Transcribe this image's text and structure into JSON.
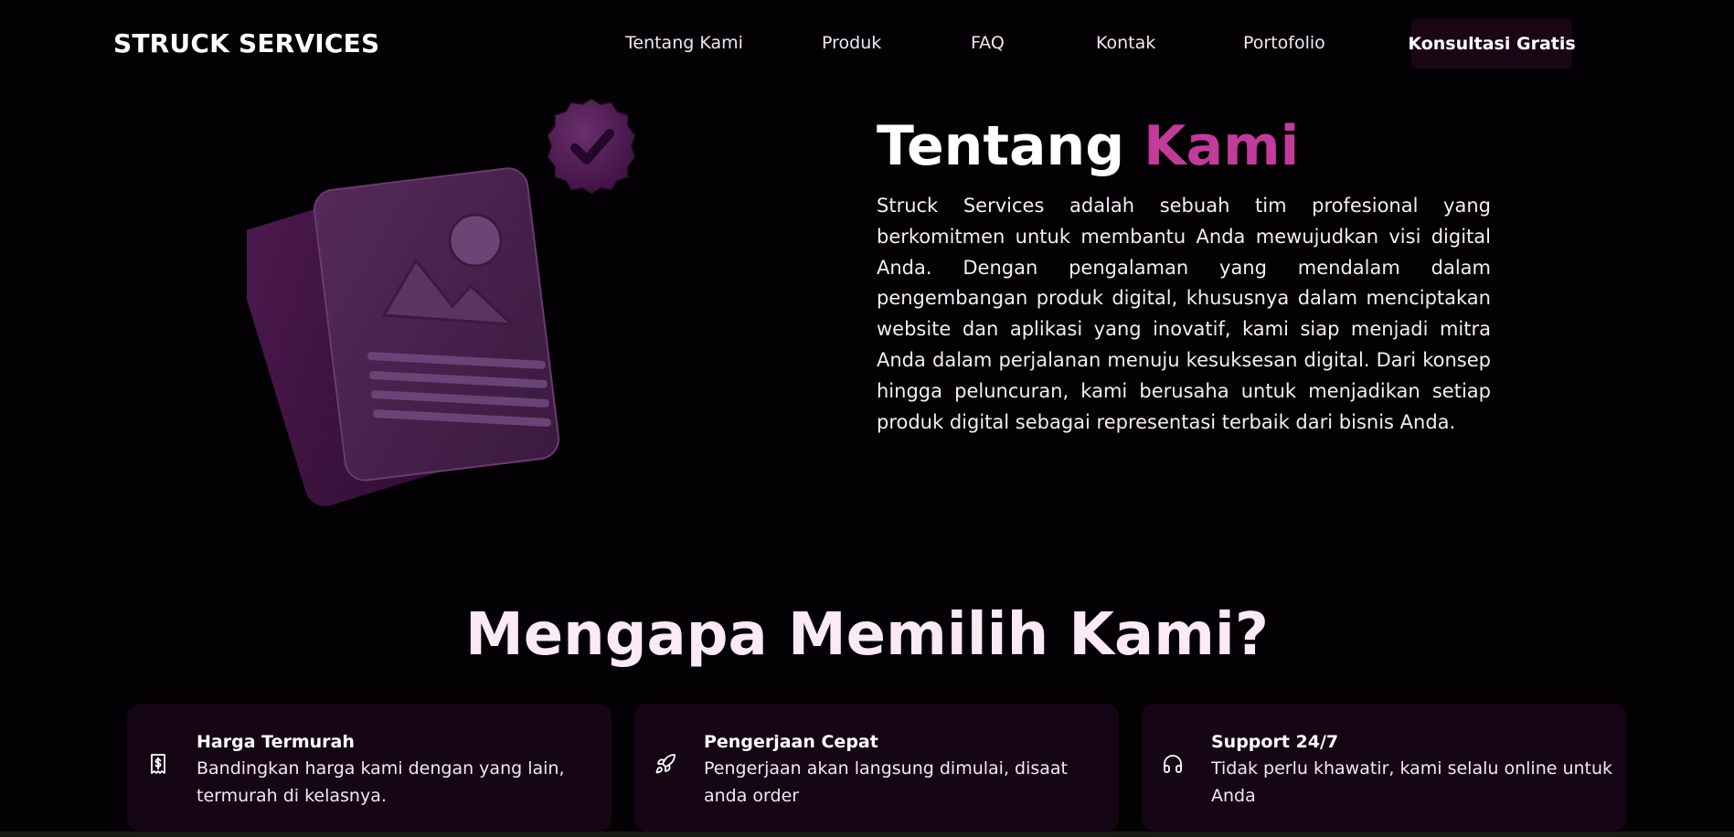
{
  "nav": {
    "brand": "STRUCK SERVICES",
    "links": [
      "Tentang Kami",
      "Produk",
      "FAQ",
      "Kontak",
      "Portofolio"
    ],
    "cta": "Konsultasi Gratis"
  },
  "about": {
    "title_main": "Tentang",
    "title_accent": "Kami",
    "text": "Struck Services adalah sebuah tim profesional yang berkomitmen untuk membantu Anda mewujudkan visi digital Anda. Dengan pengalaman yang mendalam dalam pengembangan produk digital, khususnya dalam menciptakan website dan aplikasi yang inovatif, kami siap menjadi mitra Anda dalam perjalanan menuju kesuksesan digital. Dari konsep hingga peluncuran, kami berusaha untuk menjadikan setiap produk digital sebagai representasi terbaik dari bisnis Anda."
  },
  "why": {
    "title": "Mengapa Memilih Kami?",
    "cards": [
      {
        "icon": "receipt-dollar-icon",
        "title": "Harga Termurah",
        "desc": "Bandingkan harga kami dengan yang lain, termurah di kelasnya."
      },
      {
        "icon": "rocket-icon",
        "title": "Pengerjaan Cepat",
        "desc": "Pengerjaan akan langsung dimulai, disaat anda order"
      },
      {
        "icon": "headphones-icon",
        "title": "Support 24/7",
        "desc": "Tidak perlu khawatir, kami selalu online untuk Anda"
      }
    ]
  },
  "colors": {
    "background": "#030103",
    "accent": "#c13b9a",
    "card_bg": "#160514",
    "illustration": "#4a1e4f"
  }
}
